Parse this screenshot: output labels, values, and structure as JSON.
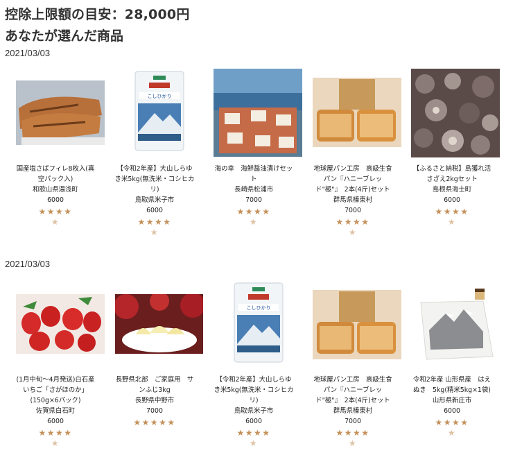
{
  "header": {
    "limit_text": "控除上限額の目安：28,000円",
    "section_title": "あなたが選んだ商品"
  },
  "groups": [
    {
      "date": "2021/03/03",
      "items": [
        {
          "name": "国産塩さばフィレ8枚入(真空パック入)",
          "name_l1": "国産塩さばフィレ8枚入(真",
          "name_l2": "空パック入)",
          "location": "和歌山県湯浅町",
          "price": "6000",
          "rating": 4.5
        },
        {
          "name": "【令和2年産】大山しらゆき米5kg(無洗米・コシヒカリ)",
          "name_l1": "【令和2年産】大山しらゆ",
          "name_l2": "き米5kg(無洗米・コシヒカ",
          "name_l3": "リ)",
          "location": "鳥取県米子市",
          "price": "6000",
          "rating": 4.5
        },
        {
          "name": "海の幸　海鮮醤油漬けセット",
          "name_l1": "海の幸　海鮮醤油漬けセッ",
          "name_l2": "ト",
          "location": "長崎県松浦市",
          "price": "7000",
          "rating": 4.5
        },
        {
          "name": "地球屋パン工房　高級生食パン『ハニーブレッド\"極\"』　2本(4斤)セット",
          "name_l1": "地球屋パン工房　高級生食",
          "name_l2": "パン『ハニーブレッ",
          "name_l3": "ド\"極\"』　2本(4斤)セット",
          "location": "群馬県榛東村",
          "price": "7000",
          "rating": 4.5
        },
        {
          "name": "【ふるさと納税】島獲れ活さざえ2kgセット",
          "name_l1": "【ふるさと納税】島獲れ活",
          "name_l2": "さざえ2kgセット",
          "location": "島根県海士町",
          "price": "6000",
          "rating": 4.5
        }
      ]
    },
    {
      "date": "2021/03/03",
      "items": [
        {
          "name": "(1月中旬～4月発送)白石産いちご「さがほのか」(150g×6パック)",
          "name_l1": "(1月中旬～4月発送)白石産",
          "name_l2": "いちご「さがほのか」",
          "name_l3": "(150g×6パック)",
          "location": "佐賀県白石町",
          "price": "6000",
          "rating": 4.5
        },
        {
          "name": "長野県北部　ご家庭用　サンふじ3kg",
          "name_l1": "長野県北部　ご家庭用　サ",
          "name_l2": "ンふじ3kg",
          "location": "長野県中野市",
          "price": "7000",
          "rating": 5
        },
        {
          "name": "【令和2年産】大山しらゆき米5kg(無洗米・コシヒカリ)",
          "name_l1": "【令和2年産】大山しらゆ",
          "name_l2": "き米5kg(無洗米・コシヒカ",
          "name_l3": "リ)",
          "location": "鳥取県米子市",
          "price": "6000",
          "rating": 4.5
        },
        {
          "name": "地球屋パン工房　高級生食パン『ハニーブレッド\"極\"』　2本(4斤)セット",
          "name_l1": "地球屋パン工房　高級生食",
          "name_l2": "パン『ハニーブレッ",
          "name_l3": "ド\"極\"』　2本(4斤)セット",
          "location": "群馬県榛東村",
          "price": "7000",
          "rating": 4.5
        },
        {
          "name": "令和2年産 山形県産　はえぬき　5kg(精米5kg×1袋)",
          "name_l1": "令和2年産 山形県産　はえ",
          "name_l2": "ぬき　5kg(精米5kg×1袋)",
          "location": "山形県新庄市",
          "price": "6000",
          "rating": 4.5
        }
      ]
    }
  ],
  "colors": {
    "star": "#c4915a",
    "text": "#333333"
  },
  "icons": {
    "star": "star-icon",
    "half_star": "half-star-icon"
  }
}
